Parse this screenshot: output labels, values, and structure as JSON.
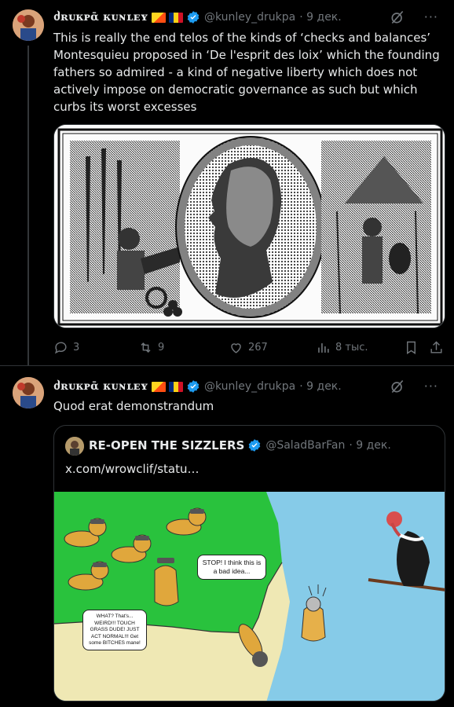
{
  "tweet1": {
    "author_name": "ძʀᴜᴋᴘᾱ ᴋᴜɴʟᴇʏ",
    "handle": "@kunley_drukpa",
    "time": "· 9 дек.",
    "text": "This is really the end telos of the kinds of ‘checks and balances’ Montesquieu proposed in ‘De l'esprit des loix’ which the founding fathers so admired - a kind of negative liberty which does not actively impose on democratic governance as such but which curbs its worst excesses",
    "stats": {
      "replies": "3",
      "reposts": "9",
      "likes": "267",
      "views": "8 тыс."
    }
  },
  "tweet2": {
    "author_name": "ძʀᴜᴋᴘᾱ ᴋᴜɴʟᴇʏ",
    "handle": "@kunley_drukpa",
    "time": "· 9 дек.",
    "text": "Quod erat demonstrandum",
    "quote": {
      "author_name": "RE-OPEN THE SIZZLERS",
      "handle": "@SaladBarFan",
      "time": "· 9 дек.",
      "text": "x.com/wrowclif/statu…",
      "comic": {
        "bubble_stop": "STOP! I think this is a bad idea...",
        "bubble_weird": "WHAT? That's... WEIRD!!! TOUCH GRASS DUDE! JUST ACT NORMAL!!! Get some BITCHES mane!"
      }
    }
  },
  "icons": [
    "avatar",
    "flag-bhutan-icon",
    "flag-romania-icon",
    "verified-icon",
    "grok-icon",
    "more-icon",
    "reply-icon",
    "repost-icon",
    "like-icon",
    "views-icon",
    "bookmark-icon",
    "share-icon"
  ],
  "colors": {
    "background": "#000000",
    "text": "#e7e9ea",
    "secondary": "#71767b",
    "verified": "#1d9bf0",
    "border": "#2f3336"
  }
}
